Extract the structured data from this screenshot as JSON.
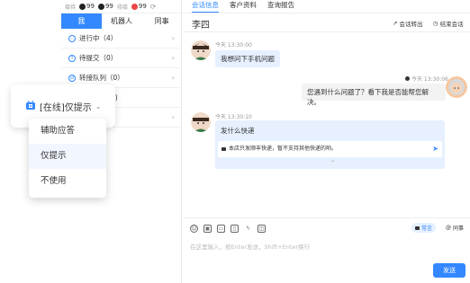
{
  "statusbar": {
    "label1": "接待",
    "count1": "99",
    "count2": "99",
    "label3": "待接",
    "count3": "99",
    "color_badge": "#ee4444"
  },
  "tabs": [
    {
      "label": "我"
    },
    {
      "label": "机器人"
    },
    {
      "label": "同事"
    }
  ],
  "list": [
    {
      "label": "进行中（4）"
    },
    {
      "label": "待提交（0）"
    },
    {
      "label": "转接队列（0）"
    },
    {
      "label": "(0)"
    },
    {
      "label": ""
    }
  ],
  "toptabs": [
    {
      "label": "会话信息"
    },
    {
      "label": "客户资料"
    },
    {
      "label": "查询报告"
    }
  ],
  "header": {
    "name": "李四",
    "transfer": "会话转出",
    "end": "结束会话"
  },
  "messages": [
    {
      "side": "left",
      "time": "今天 13:30:00",
      "text": "我想问下手机问题"
    },
    {
      "side": "right",
      "time": "今天 13:30:06",
      "text": "您遇到什么问题了？看下我是否能帮您解决。"
    },
    {
      "side": "left",
      "time": "今天 13:30:10",
      "text": "发什么快递"
    }
  ],
  "suggestion": {
    "text": "本店只发顺丰快递，暂不支持其他快递的哟。"
  },
  "input": {
    "placeholder": "在这里输入，按Enter发送，Shift+Enter换行",
    "send_label": "发送",
    "pill1": "常言",
    "pill2": "同事"
  },
  "popup": {
    "mode_label": "[在线]仅提示",
    "menu": [
      "辅助应答",
      "仅提示",
      "不使用"
    ],
    "selected_index": 1
  },
  "colors": {
    "accent": "#3388ff",
    "bubble_left": "#e6f0ff",
    "bubble_right": "#f3f3f3"
  }
}
